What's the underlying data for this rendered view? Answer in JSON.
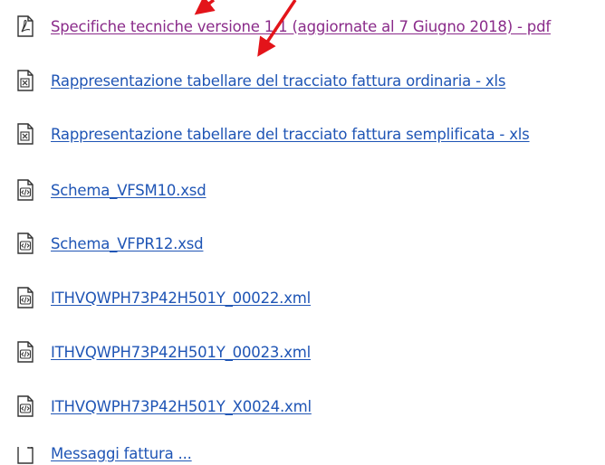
{
  "colors": {
    "link": "#1f55b5",
    "visited": "#8a2b8a",
    "arrow": "#e3141a"
  },
  "files": [
    {
      "label": "Specifiche tecniche versione 1.1 (aggiornate al 7 Giugno 2018) - pdf",
      "icon": "pdf-file-icon",
      "visited": true
    },
    {
      "label": "Rappresentazione tabellare del tracciato fattura ordinaria - xls",
      "icon": "xls-file-icon",
      "visited": false
    },
    {
      "label": "Rappresentazione tabellare del tracciato fattura semplificata - xls",
      "icon": "xls-file-icon",
      "visited": false
    },
    {
      "label": "Schema_VFSM10.xsd",
      "icon": "code-file-icon",
      "visited": false
    },
    {
      "label": "Schema_VFPR12.xsd",
      "icon": "code-file-icon",
      "visited": false
    },
    {
      "label": "ITHVQWPH73P42H501Y_00022.xml",
      "icon": "code-file-icon",
      "visited": false
    },
    {
      "label": "ITHVQWPH73P42H501Y_00023.xml",
      "icon": "code-file-icon",
      "visited": false
    },
    {
      "label": "ITHVQWPH73P42H501Y_X0024.xml",
      "icon": "code-file-icon",
      "visited": false
    },
    {
      "label": "Messaggi fattura ...",
      "icon": "code-file-icon",
      "visited": false
    }
  ]
}
